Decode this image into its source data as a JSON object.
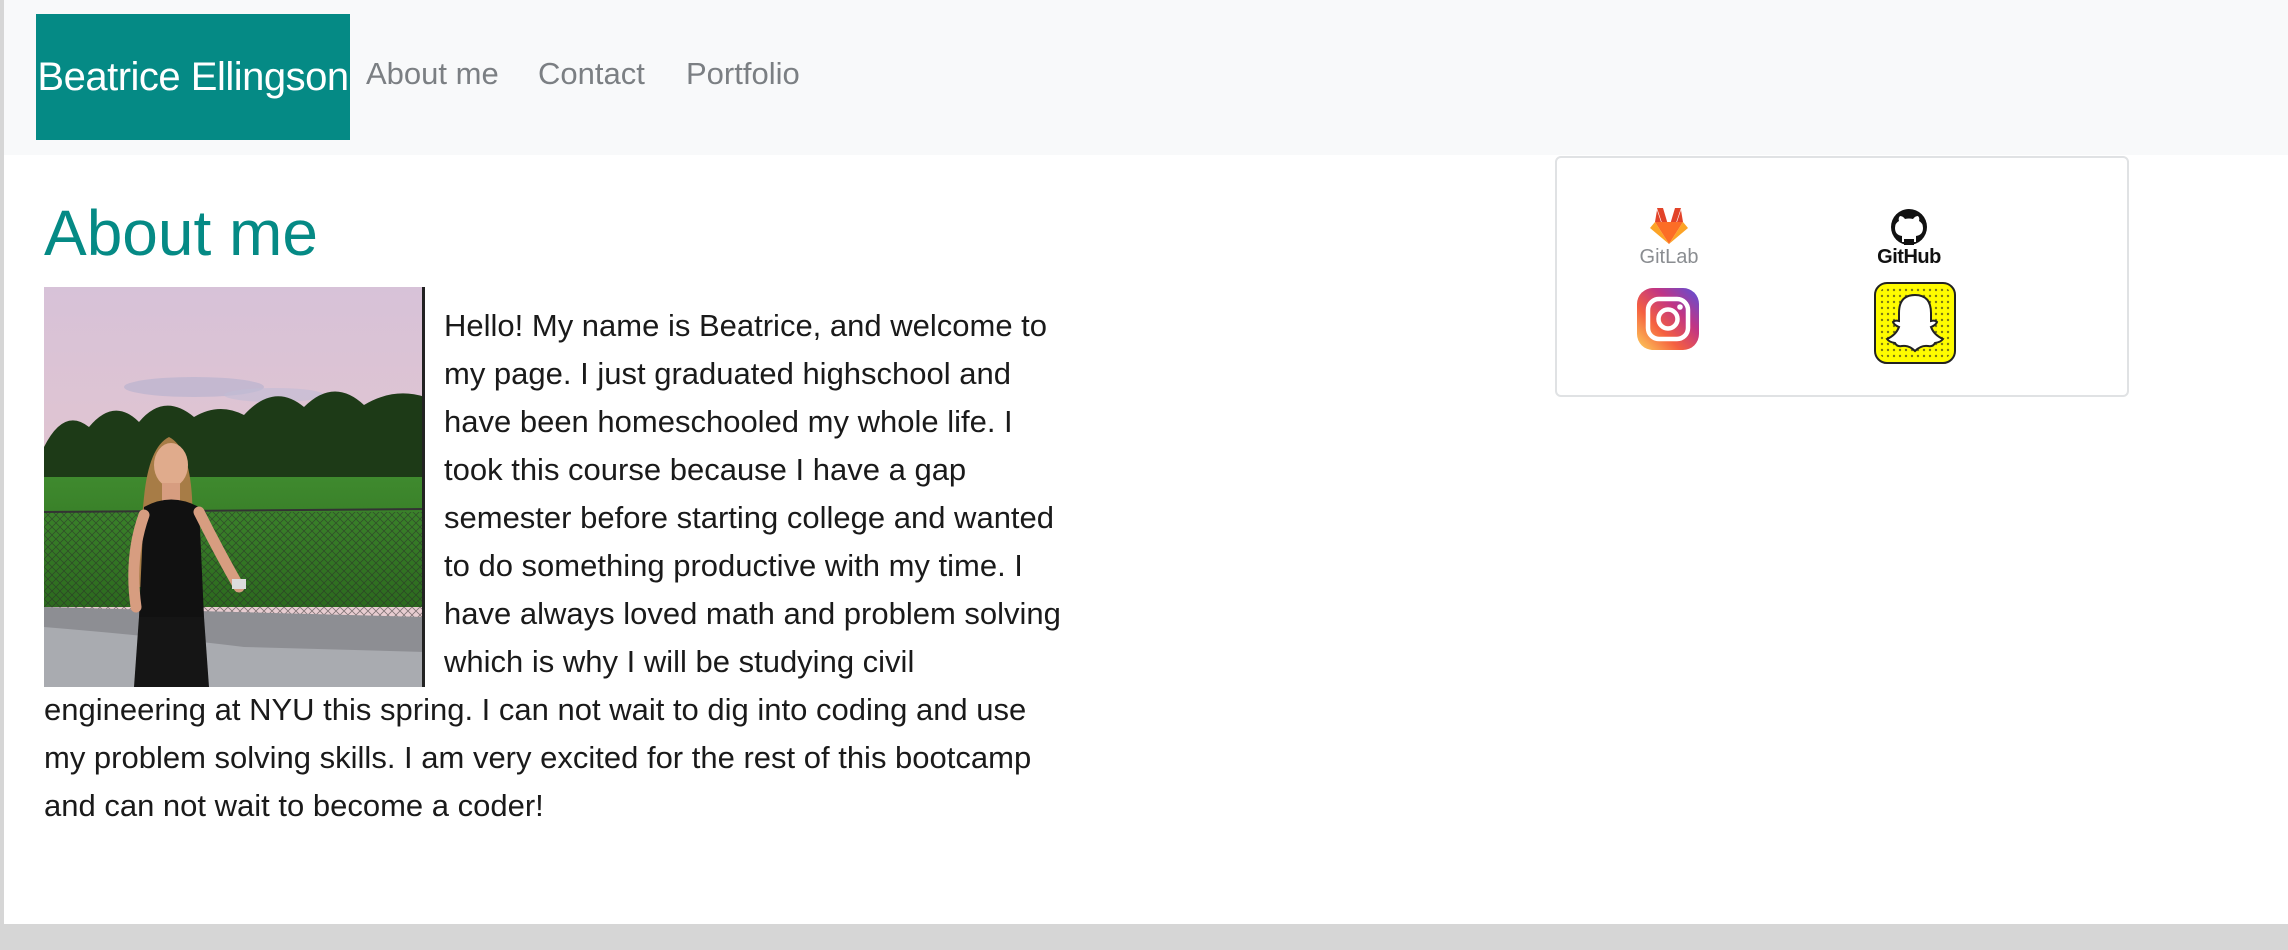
{
  "navbar": {
    "brand": "Beatrice Ellingson",
    "links": [
      "About me",
      "Contact",
      "Portfolio"
    ]
  },
  "about": {
    "heading": "About me",
    "photo": "portrait-photo",
    "bio_lines": [
      "Hello! My name is Beatrice, and welcome to",
      "my page. I just graduated highschool and",
      "have been homeschooled my whole life. I",
      "took this course because I have a gap",
      "semester before starting college and wanted",
      "to do something productive with my time. I",
      "have always loved math and problem solving",
      "which is why I will be studying civil",
      "engineering at NYU this spring. I can not wait to dig into coding and use",
      "my problem solving skills. I am very excited for the rest of this bootcamp",
      "and can not wait to become a coder!"
    ]
  },
  "social": {
    "gitlab": {
      "icon": "gitlab-icon",
      "label": "GitLab"
    },
    "github": {
      "icon": "github-icon",
      "label": "GitHub"
    },
    "instagram": {
      "icon": "instagram-icon"
    },
    "snapchat": {
      "icon": "snapchat-icon"
    }
  },
  "colors": {
    "accent": "#058a85",
    "navbar_bg": "#f8f9fa",
    "nav_link": "#7b7f83",
    "body_text": "#1a1a1a",
    "page_frame": "#d6d6d6"
  }
}
